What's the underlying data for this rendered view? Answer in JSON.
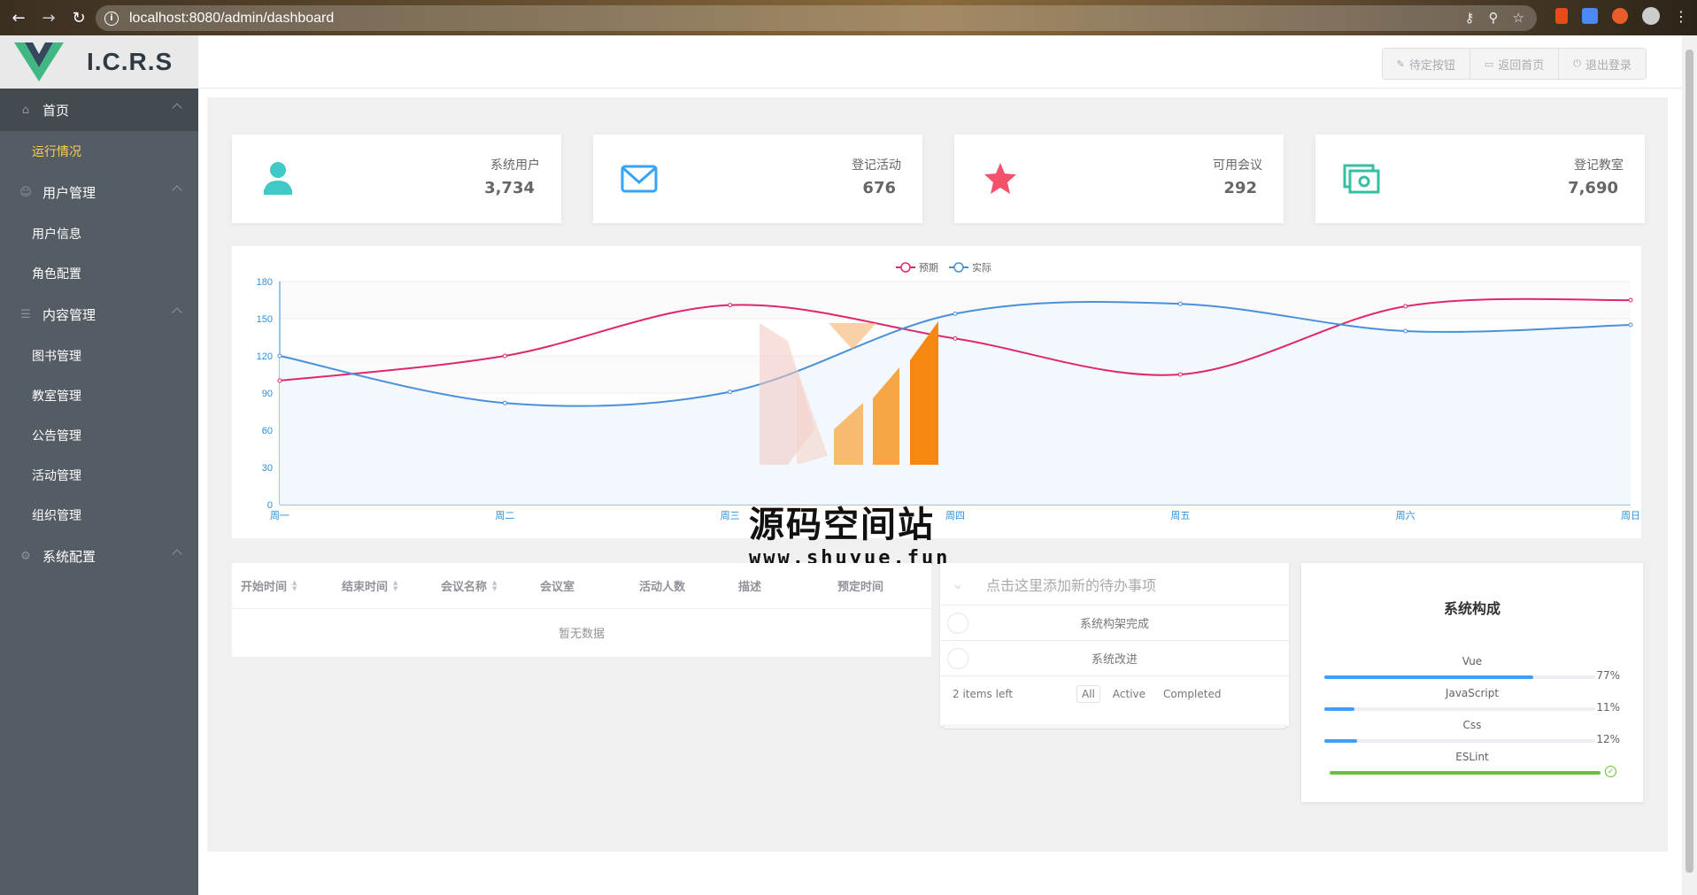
{
  "browser": {
    "url": "localhost:8080/admin/dashboard"
  },
  "app": {
    "logo_text": "I.C.R.S"
  },
  "sidebar": {
    "groups": [
      {
        "label": "首页",
        "icon": "home-icon",
        "items": [
          "运行情况"
        ]
      },
      {
        "label": "用户管理",
        "icon": "user-icon",
        "items": [
          "用户信息",
          "角色配置"
        ]
      },
      {
        "label": "内容管理",
        "icon": "document-icon",
        "items": [
          "图书管理",
          "教室管理",
          "公告管理",
          "活动管理",
          "组织管理"
        ]
      },
      {
        "label": "系统配置",
        "icon": "gear-icon",
        "items": []
      }
    ],
    "current_item": "运行情况"
  },
  "header": {
    "buttons": [
      {
        "label": "待定按钮",
        "icon": "edit-icon"
      },
      {
        "label": "返回首页",
        "icon": "monitor-icon"
      },
      {
        "label": "退出登录",
        "icon": "power-icon"
      }
    ]
  },
  "stats": [
    {
      "label": "系统用户",
      "value": "3,734",
      "icon": "user-icon",
      "color": "#40c9c6"
    },
    {
      "label": "登记活动",
      "value": "676",
      "icon": "envelope-icon",
      "color": "#36a3f7"
    },
    {
      "label": "可用会议",
      "value": "292",
      "icon": "star-icon",
      "color": "#f4516c"
    },
    {
      "label": "登记教室",
      "value": "7,690",
      "icon": "money-icon",
      "color": "#34bfa3"
    }
  ],
  "chart_data": {
    "type": "line",
    "categories": [
      "周一",
      "周二",
      "周三",
      "周四",
      "周五",
      "周六",
      "周日"
    ],
    "series": [
      {
        "name": "预期",
        "color": "#e0266d",
        "values": [
          100,
          120,
          161,
          134,
          105,
          160,
          165
        ]
      },
      {
        "name": "实际",
        "color": "#4a90d9",
        "values": [
          120,
          82,
          91,
          154,
          162,
          140,
          145
        ]
      }
    ],
    "ylim": [
      0,
      180
    ],
    "yticks": [
      0,
      30,
      60,
      90,
      120,
      150,
      180
    ],
    "legend": "top-center",
    "grid": true
  },
  "watermark": {
    "title": "源码空间站",
    "url": "www.shuyue.fun"
  },
  "table": {
    "columns": [
      {
        "label": "开始时间",
        "sortable": true
      },
      {
        "label": "结束时间",
        "sortable": true
      },
      {
        "label": "会议名称",
        "sortable": true
      },
      {
        "label": "会议室",
        "sortable": false
      },
      {
        "label": "活动人数",
        "sortable": false
      },
      {
        "label": "描述",
        "sortable": false
      },
      {
        "label": "预定时间",
        "sortable": false
      }
    ],
    "empty_text": "暂无数据"
  },
  "todo": {
    "placeholder": "点击这里添加新的待办事项",
    "items": [
      "系统构架完成",
      "系统改进"
    ],
    "items_left": "2 items left",
    "filters": [
      "All",
      "Active",
      "Completed"
    ],
    "selected_filter": "All"
  },
  "system": {
    "title": "系统构成",
    "items": [
      {
        "name": "Vue",
        "percent": 77,
        "label": "77%",
        "color": "#409eff"
      },
      {
        "name": "JavaScript",
        "percent": 11,
        "label": "11%",
        "color": "#409eff"
      },
      {
        "name": "Css",
        "percent": 12,
        "label": "12%",
        "color": "#409eff"
      },
      {
        "name": "ESLint",
        "percent": 100,
        "label": "",
        "color": "#67c23a",
        "status": "success"
      }
    ]
  }
}
